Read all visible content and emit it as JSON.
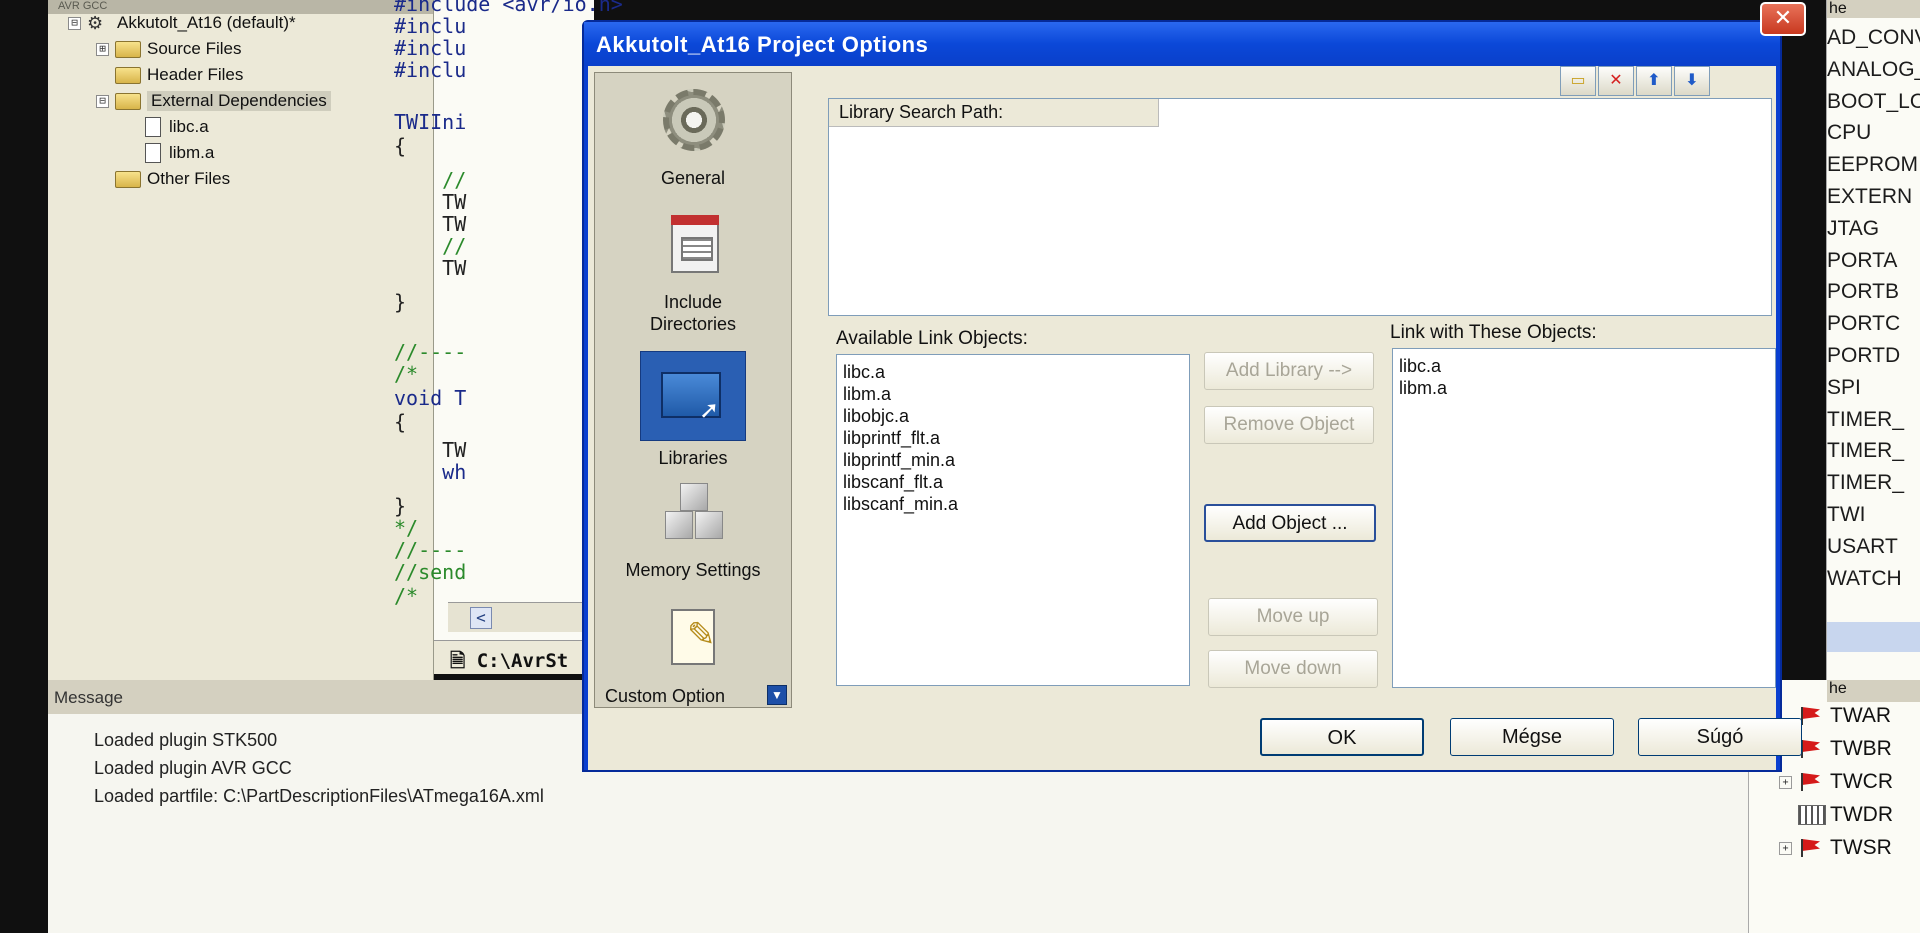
{
  "ide": {
    "tree_caption": "AVR GCC",
    "project_tree": [
      {
        "label": "Akkutolt_At16 (default)*",
        "kind": "project",
        "expander": "⊟"
      },
      {
        "label": "Source Files",
        "kind": "folder",
        "expander": "⊞"
      },
      {
        "label": "Header Files",
        "kind": "folder",
        "expander": ""
      },
      {
        "label": "External Dependencies",
        "kind": "folder",
        "expander": "⊟"
      },
      {
        "label": "libc.a",
        "kind": "file",
        "expander": ""
      },
      {
        "label": "libm.a",
        "kind": "file",
        "expander": ""
      },
      {
        "label": "Other Files",
        "kind": "folder",
        "expander": ""
      }
    ],
    "code_lines": [
      {
        "text": "#include <avr/io.h>",
        "cls": "c-dir"
      },
      {
        "text": "#inclu",
        "cls": "c-dir"
      },
      {
        "text": "#inclu",
        "cls": "c-dir"
      },
      {
        "text": "#inclu",
        "cls": "c-dir"
      },
      {
        "text": "TWIIni",
        "cls": "c-fn"
      },
      {
        "text": "{",
        "cls": "c-tx"
      },
      {
        "text": "    //",
        "cls": "c-cm"
      },
      {
        "text": "    TW",
        "cls": "c-tx"
      },
      {
        "text": "    TW",
        "cls": "c-tx"
      },
      {
        "text": "    //",
        "cls": "c-cm"
      },
      {
        "text": "    TW",
        "cls": "c-tx"
      },
      {
        "text": "}",
        "cls": "c-tx"
      },
      {
        "text": "//----",
        "cls": "c-cm"
      },
      {
        "text": "/*",
        "cls": "c-cm"
      },
      {
        "text": "void T",
        "cls": "c-fn"
      },
      {
        "text": "{",
        "cls": "c-tx"
      },
      {
        "text": "    TW",
        "cls": "c-tx"
      },
      {
        "text": "    wh",
        "cls": "c-fn"
      },
      {
        "text": "}",
        "cls": "c-tx"
      },
      {
        "text": "*/",
        "cls": "c-cm"
      },
      {
        "text": "//----",
        "cls": "c-cm"
      },
      {
        "text": "//send",
        "cls": "c-cm"
      },
      {
        "text": "/*",
        "cls": "c-cm"
      }
    ],
    "scroll_left": "<",
    "editor_tab": "C:\\AvrSt",
    "message_caption": "Message",
    "messages": [
      "Loaded plugin STK500",
      "Loaded plugin AVR GCC",
      "Loaded partfile: C:\\PartDescriptionFiles\\ATmega16A.xml"
    ],
    "io_header": "he",
    "io_items": [
      "AD_CONV",
      "ANALOG_",
      "BOOT_LO",
      "CPU",
      "EEPROM",
      "EXTERN",
      "JTAG",
      "PORTA",
      "PORTB",
      "PORTC",
      "PORTD",
      "SPI",
      "TIMER_",
      "TIMER_",
      "TIMER_",
      "TWI",
      "USART",
      "WATCH"
    ],
    "reg_header": "he",
    "registers": [
      {
        "label": "TWAR",
        "icon": "flag",
        "expander": ""
      },
      {
        "label": "TWBR",
        "icon": "flag",
        "expander": ""
      },
      {
        "label": "TWCR",
        "icon": "flag",
        "expander": "+"
      },
      {
        "label": "TWDR",
        "icon": "grid",
        "expander": ""
      },
      {
        "label": "TWSR",
        "icon": "flag",
        "expander": "+"
      }
    ]
  },
  "dialog": {
    "title": "Akkutolt_At16 Project Options",
    "close_label": "✕",
    "nav": [
      {
        "label": "General",
        "icon": "gear-icon"
      },
      {
        "label": "Include Directories",
        "icon": "include-directories-icon"
      },
      {
        "label": "Libraries",
        "icon": "libraries-icon",
        "active": true
      },
      {
        "label": "Memory Settings",
        "icon": "memory-cubes-icon"
      },
      {
        "label": "Custom Option",
        "icon": "notepad-pencil-icon"
      }
    ],
    "toolbar": {
      "new_folder": "▭",
      "delete": "✕",
      "move_up": "⬆",
      "move_down": "⬇"
    },
    "search_path_header": "Library Search Path:",
    "available_label": "Available Link Objects:",
    "available": [
      "libc.a",
      "libm.a",
      "libobjc.a",
      "libprintf_flt.a",
      "libprintf_min.a",
      "libscanf_flt.a",
      "libscanf_min.a"
    ],
    "linked_label": "Link with These Objects:",
    "linked": [
      "libc.a",
      "libm.a"
    ],
    "buttons": {
      "add_library": "Add Library -->",
      "remove_object": "Remove Object",
      "add_object": "Add Object ...",
      "move_up": "Move up",
      "move_down": "Move down"
    },
    "footer": {
      "ok": "OK",
      "cancel": "Mégse",
      "help": "Súgó"
    }
  }
}
